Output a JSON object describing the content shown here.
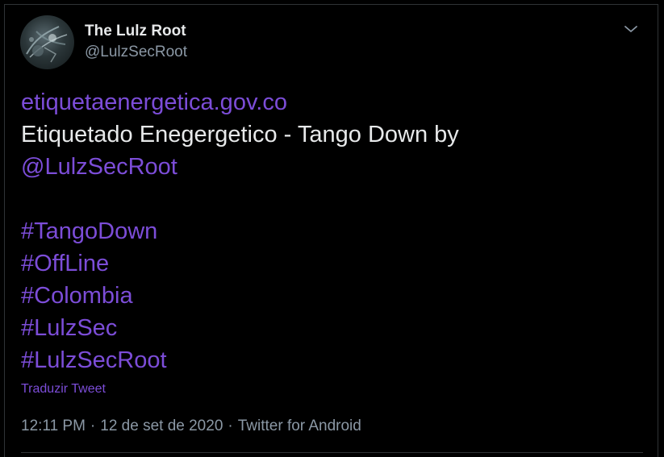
{
  "author": {
    "display_name": "The Lulz Root",
    "handle": "@LulzSecRoot"
  },
  "tweet": {
    "link_domain": "etiquetaenergetica.gov.co",
    "text_line": "Etiquetado Enegergetico - Tango Down by",
    "mention": "@LulzSecRoot",
    "hashtags": [
      "#TangoDown",
      "#OffLine",
      "#Colombia",
      "#LulzSec",
      "#LulzSecRoot"
    ],
    "translate_label": "Traduzir Tweet"
  },
  "meta": {
    "time": "12:11 PM",
    "separator": "·",
    "date": "12 de set de 2020",
    "source": "Twitter for Android"
  },
  "icons": {
    "more": "chevron-down-icon"
  },
  "colors": {
    "background": "#000000",
    "link": "#7c4dd8",
    "text": "#e7e9ea",
    "secondary_text": "#8b98a5",
    "border": "#2f3336"
  }
}
